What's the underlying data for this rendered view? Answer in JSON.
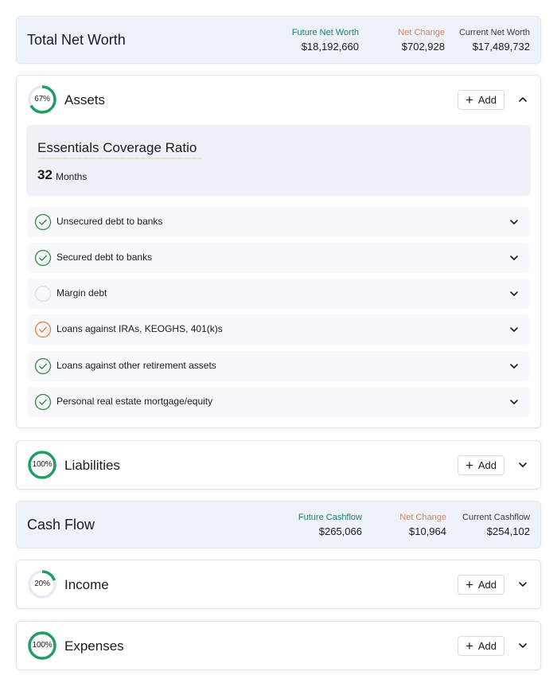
{
  "net_worth": {
    "title": "Total Net Worth",
    "metrics": [
      {
        "label": "Future Net Worth",
        "value": "$18,192,660",
        "color": "#1d7a78"
      },
      {
        "label": "Net Change",
        "value": "$702,928",
        "color": "#e0804a"
      },
      {
        "label": "Current Net Worth",
        "value": "$17,489,732",
        "color": "#3a3a40"
      }
    ]
  },
  "assets": {
    "progress_label": "67%",
    "progress": 0.67,
    "title": "Assets",
    "add_label": "Add",
    "coverage": {
      "title": "Essentials Coverage Ratio",
      "value": "32",
      "unit": "Months"
    },
    "items": [
      {
        "label": "Unsecured debt to banks",
        "status": "complete"
      },
      {
        "label": "Secured debt to banks",
        "status": "complete"
      },
      {
        "label": "Margin debt",
        "status": "empty"
      },
      {
        "label": "Loans against IRAs, KEOGHS, 401(k)s",
        "status": "warning"
      },
      {
        "label": "Loans against other retirement assets",
        "status": "complete"
      },
      {
        "label": "Personal real estate mortgage/equity",
        "status": "complete"
      }
    ]
  },
  "liabilities": {
    "progress_label": "100%",
    "progress": 1.0,
    "title": "Liabilities",
    "add_label": "Add"
  },
  "cash_flow": {
    "title": "Cash Flow",
    "metrics": [
      {
        "label": "Future Cashflow",
        "value": "$265,066",
        "color": "#1d7a78"
      },
      {
        "label": "Net Change",
        "value": "$10,964",
        "color": "#e0804a"
      },
      {
        "label": "Current Cashflow",
        "value": "$254,102",
        "color": "#3a3a40"
      }
    ]
  },
  "income": {
    "progress_label": "20%",
    "progress": 0.2,
    "title": "Income",
    "add_label": "Add"
  },
  "expenses": {
    "progress_label": "100%",
    "progress": 1.0,
    "title": "Expenses",
    "add_label": "Add"
  },
  "colors": {
    "ring_progress": "#1f9d63",
    "ring_track": "#e6eaf2",
    "check_complete": "#2e8b3e",
    "check_warning": "#e0803a",
    "check_empty": "#d9dde4"
  }
}
